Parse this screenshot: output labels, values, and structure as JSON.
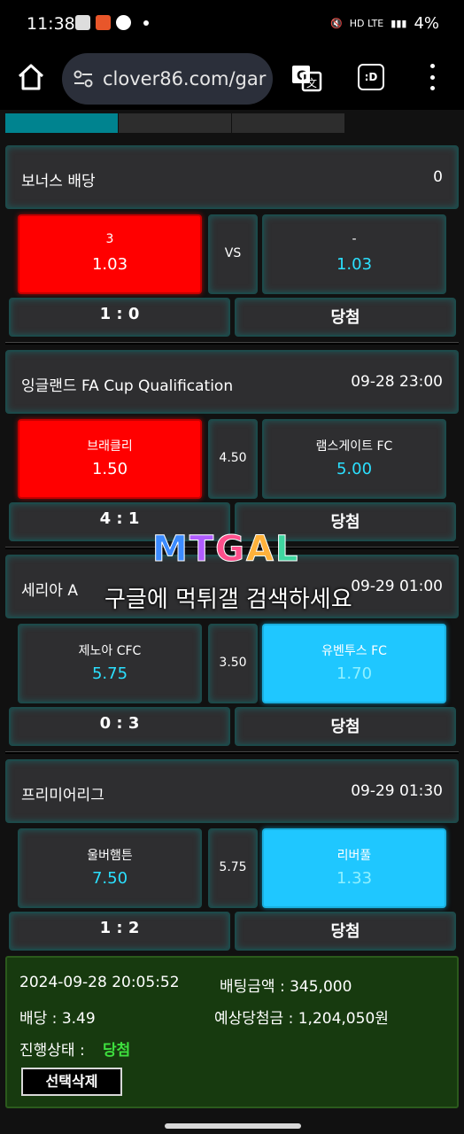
{
  "status_bar": {
    "time": "11:38",
    "network": "HD LTE",
    "battery": "4%"
  },
  "browser": {
    "url": "clover86.com/gar",
    "tab_label": ":D"
  },
  "matches": [
    {
      "league": "보너스 배당",
      "time": "0",
      "home": {
        "team": "3",
        "odd": "1.03"
      },
      "middle": "VS",
      "away": {
        "team": "-",
        "odd": "1.03"
      },
      "score": "1 : 0",
      "result": "당첨"
    },
    {
      "league": "잉글랜드 FA Cup Qualification",
      "time": "09-28 23:00",
      "home": {
        "team": "브래클리",
        "odd": "1.50"
      },
      "middle": "4.50",
      "away": {
        "team": "램스게이트 FC",
        "odd": "5.00"
      },
      "score": "4 : 1",
      "result": "당첨"
    },
    {
      "league": "세리아 A",
      "time": "09-29 01:00",
      "home": {
        "team": "제노아 CFC",
        "odd": "5.75"
      },
      "middle": "3.50",
      "away": {
        "team": "유벤투스 FC",
        "odd": "1.70"
      },
      "score": "0 : 3",
      "result": "당첨"
    },
    {
      "league": "프리미어리그",
      "time": "09-29 01:30",
      "home": {
        "team": "울버햄튼",
        "odd": "7.50"
      },
      "middle": "5.75",
      "away": {
        "team": "리버풀",
        "odd": "1.33"
      },
      "score": "1 : 2",
      "result": "당첨"
    }
  ],
  "watermark": {
    "logo": "MTGAL",
    "text": "구글에 먹튀갤 검색하세요"
  },
  "summary": {
    "datetime": "2024-09-28 20:05:52",
    "bet_amount": "배팅금액 : 345,000",
    "odds": "배당 : 3.49",
    "expected_win": "예상당첨금 : 1,204,050원",
    "status_label": "진행상태 :",
    "status_value": "당첨",
    "delete_label": "선택삭제"
  }
}
